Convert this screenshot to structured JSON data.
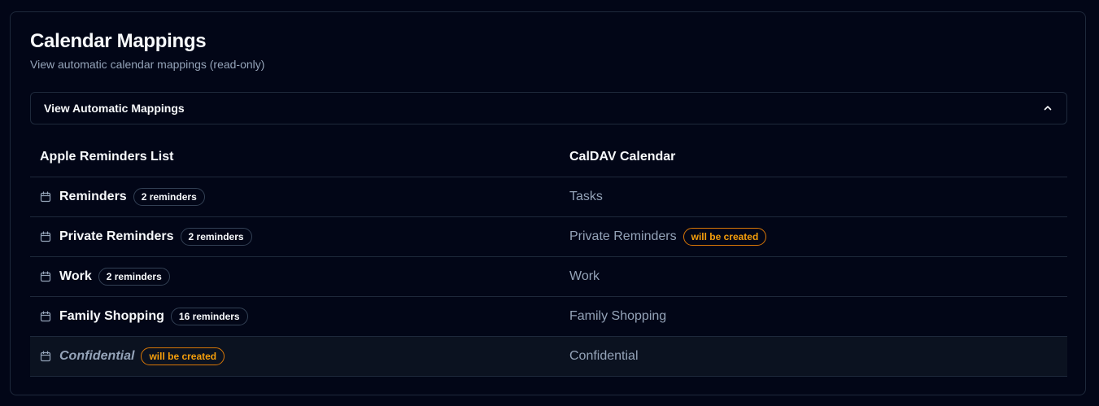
{
  "header": {
    "title": "Calendar Mappings",
    "subtitle": "View automatic calendar mappings (read-only)"
  },
  "accordion": {
    "label": "View Automatic Mappings",
    "expanded": true
  },
  "table": {
    "columns": [
      "Apple Reminders List",
      "CalDAV Calendar"
    ],
    "rows": [
      {
        "list": "Reminders",
        "badge": "2 reminders",
        "target": "Tasks",
        "target_badge": ""
      },
      {
        "list": "Private Reminders",
        "badge": "2 reminders",
        "target": "Private Reminders",
        "target_badge": "will be created"
      },
      {
        "list": "Work",
        "badge": "2 reminders",
        "target": "Work",
        "target_badge": ""
      },
      {
        "list": "Family Shopping",
        "badge": "16 reminders",
        "target": "Family Shopping",
        "target_badge": ""
      },
      {
        "list": "Confidential",
        "badge": "will be created",
        "target": "Confidential",
        "target_badge": ""
      }
    ]
  },
  "colors": {
    "background": "#020617",
    "border": "#1e293b",
    "text": "#f8fafc",
    "muted": "#94a3b8",
    "warning": "#f59e0b"
  }
}
